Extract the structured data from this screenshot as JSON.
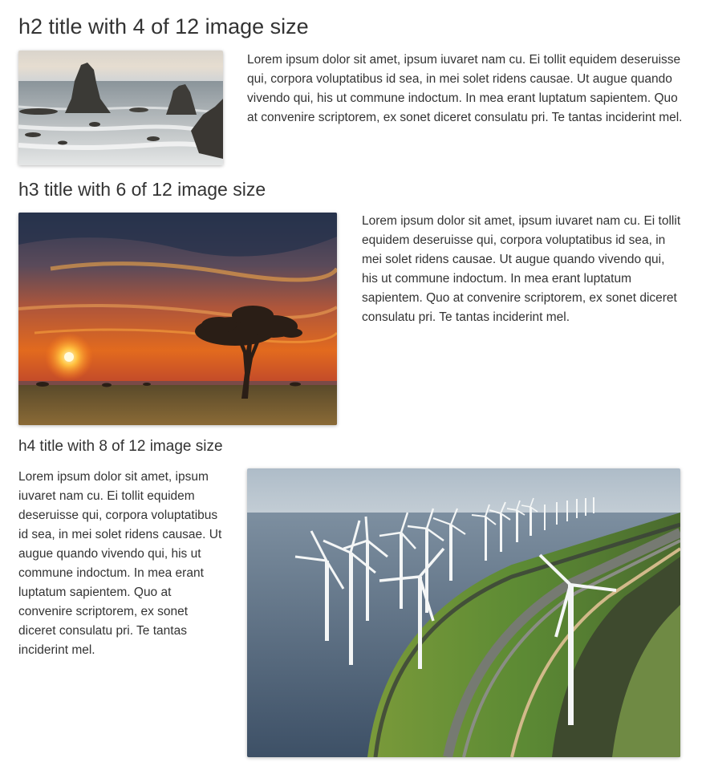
{
  "sections": [
    {
      "title": "h2 title with 4 of 12 image size",
      "body": "Lorem ipsum dolor sit amet, ipsum iuvaret nam cu. Ei tollit equidem deseruisse qui, corpora voluptatibus id sea, in mei solet ridens causae. Ut augue quando vivendo qui, his ut commune indoctum. In mea erant luptatum sapientem. Quo at convenire scriptorem, ex sonet diceret consulatu pri. Te tantas inciderint mel.",
      "image_icon": "sea-stacks-photo"
    },
    {
      "title": "h3 title with 6 of 12 image size",
      "body": "Lorem ipsum dolor sit amet, ipsum iuvaret nam cu. Ei tollit equidem deseruisse qui, corpora voluptatibus id sea, in mei solet ridens causae. Ut augue quando vivendo qui, his ut commune indoctum. In mea erant luptatum sapientem. Quo at convenire scriptorem, ex sonet diceret consulatu pri. Te tantas inciderint mel.",
      "image_icon": "savanna-sunset-photo"
    },
    {
      "title": "h4 title with 8 of 12 image size",
      "body": "Lorem ipsum dolor sit amet, ipsum iuvaret nam cu. Ei tollit equidem deseruisse qui, corpora voluptatibus id sea, in mei solet ridens causae. Ut augue quando vivendo qui, his ut commune indoctum. In mea erant luptatum sapientem. Quo at convenire scriptorem, ex sonet diceret consulatu pri. Te tantas inciderint mel.",
      "image_icon": "wind-turbines-photo"
    }
  ],
  "colors": {
    "text": "#333333",
    "background": "#ffffff"
  }
}
